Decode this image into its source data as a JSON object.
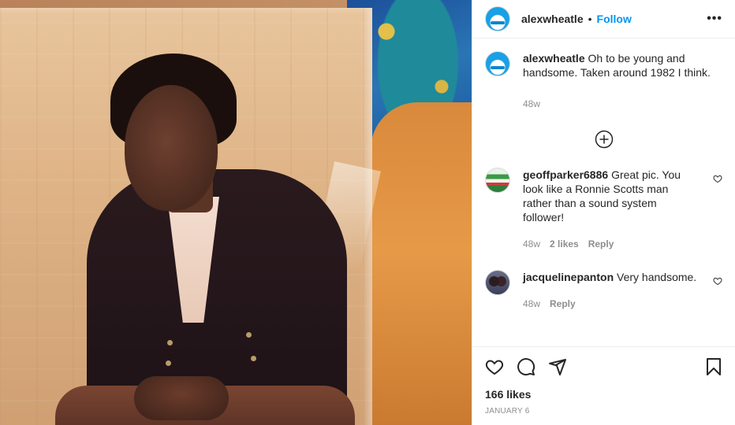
{
  "post": {
    "username": "alexwheatle",
    "separator": "•",
    "follow_label": "Follow",
    "more_label": "•••",
    "caption_user": "alexwheatle",
    "caption_text": "Oh to be young and handsome. Taken around 1982 I think.",
    "caption_age": "48w",
    "likes": "166 likes",
    "date": "JANUARY 6"
  },
  "comments": [
    {
      "user": "geoffparker6886",
      "text": "Great pic. You look like a Ronnie Scotts man rather than a sound system follower!",
      "age": "48w",
      "likes": "2 likes",
      "reply": "Reply"
    },
    {
      "user": "jacquelinepanton",
      "text": "Very handsome.",
      "age": "48w",
      "reply": "Reply"
    }
  ],
  "icons": {
    "load_more": "plus-circle-icon",
    "like": "heart-icon",
    "comment": "comment-icon",
    "share": "paper-plane-icon",
    "save": "bookmark-icon",
    "comment_like": "small-heart-icon"
  },
  "colors": {
    "link": "#0095f6",
    "text": "#262626",
    "muted": "#8e8e8e",
    "border": "#efefef"
  }
}
